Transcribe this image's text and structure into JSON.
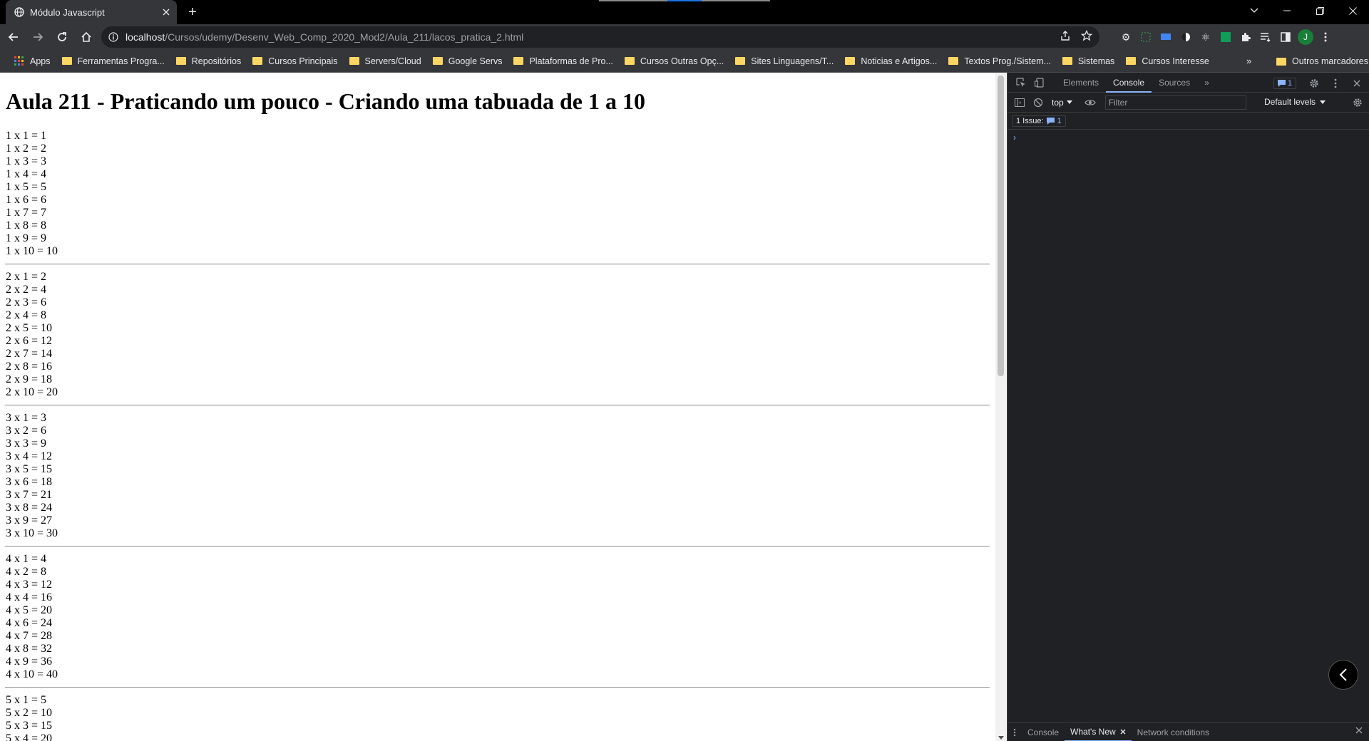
{
  "browser": {
    "tab_title": "Módulo Javascript",
    "new_tab": "+",
    "url_host": "localhost",
    "url_path": "/Cursos/udemy/Desenv_Web_Comp_2020_Mod2/Aula_211/lacos_pratica_2.html",
    "avatar_initial": "J"
  },
  "bookmarks": {
    "apps": "Apps",
    "items": [
      "Ferramentas Progra...",
      "Repositórios",
      "Cursos Principais",
      "Servers/Cloud",
      "Google Servs",
      "Plataformas de Pro...",
      "Cursos Outras Opç...",
      "Sites Linguagens/T...",
      "Noticias e Artigos...",
      "Textos Prog./Sistem...",
      "Sistemas",
      "Cursos Interesse"
    ],
    "more": "»",
    "other": "Outros marcadores"
  },
  "page": {
    "title": "Aula 211 - Praticando um pouco - Criando uma tabuada de 1 a 10",
    "blocks": [
      [
        "1 x 1 = 1",
        "1 x 2 = 2",
        "1 x 3 = 3",
        "1 x 4 = 4",
        "1 x 5 = 5",
        "1 x 6 = 6",
        "1 x 7 = 7",
        "1 x 8 = 8",
        "1 x 9 = 9",
        "1 x 10 = 10"
      ],
      [
        "2 x 1 = 2",
        "2 x 2 = 4",
        "2 x 3 = 6",
        "2 x 4 = 8",
        "2 x 5 = 10",
        "2 x 6 = 12",
        "2 x 7 = 14",
        "2 x 8 = 16",
        "2 x 9 = 18",
        "2 x 10 = 20"
      ],
      [
        "3 x 1 = 3",
        "3 x 2 = 6",
        "3 x 3 = 9",
        "3 x 4 = 12",
        "3 x 5 = 15",
        "3 x 6 = 18",
        "3 x 7 = 21",
        "3 x 8 = 24",
        "3 x 9 = 27",
        "3 x 10 = 30"
      ],
      [
        "4 x 1 = 4",
        "4 x 2 = 8",
        "4 x 3 = 12",
        "4 x 4 = 16",
        "4 x 5 = 20",
        "4 x 6 = 24",
        "4 x 7 = 28",
        "4 x 8 = 32",
        "4 x 9 = 36",
        "4 x 10 = 40"
      ],
      [
        "5 x 1 = 5",
        "5 x 2 = 10",
        "5 x 3 = 15",
        "5 x 4 = 20"
      ]
    ]
  },
  "devtools": {
    "tabs": [
      "Elements",
      "Console",
      "Sources"
    ],
    "active_tab": "Console",
    "more_tabs": "»",
    "message_count": "1",
    "context": "top",
    "filter_placeholder": "Filter",
    "levels": "Default levels",
    "issues_label": "1 Issue:",
    "issues_count": "1",
    "prompt": "›",
    "drawer_tabs": [
      "Console",
      "What's New",
      "Network conditions"
    ],
    "drawer_active": "What's New"
  }
}
